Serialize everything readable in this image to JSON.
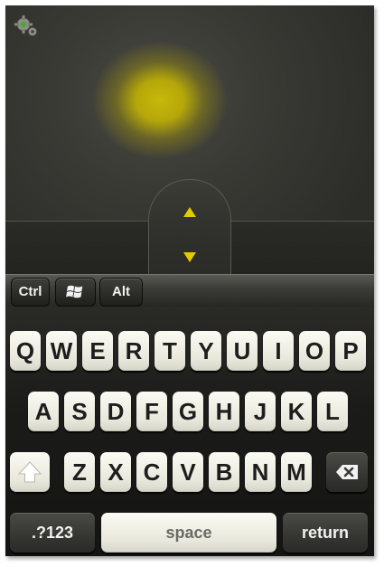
{
  "modifiers": {
    "ctrl": "Ctrl",
    "win_icon": "windows-logo-icon",
    "alt": "Alt"
  },
  "keyboard": {
    "row1": [
      "Q",
      "W",
      "E",
      "R",
      "T",
      "Y",
      "U",
      "I",
      "O",
      "P"
    ],
    "row2": [
      "A",
      "S",
      "D",
      "F",
      "G",
      "H",
      "J",
      "K",
      "L"
    ],
    "row3": [
      "Z",
      "X",
      "C",
      "V",
      "B",
      "N",
      "M"
    ],
    "numbers_label": ".?123",
    "space_label": "space",
    "return_label": "return"
  },
  "icons": {
    "settings": "gear-icon",
    "scroll_up": "arrow-up-icon",
    "scroll_down": "arrow-down-icon",
    "shift": "shift-icon",
    "backspace": "backspace-icon"
  },
  "colors": {
    "accent": "#e2c900",
    "glow": "#c8b80a"
  }
}
